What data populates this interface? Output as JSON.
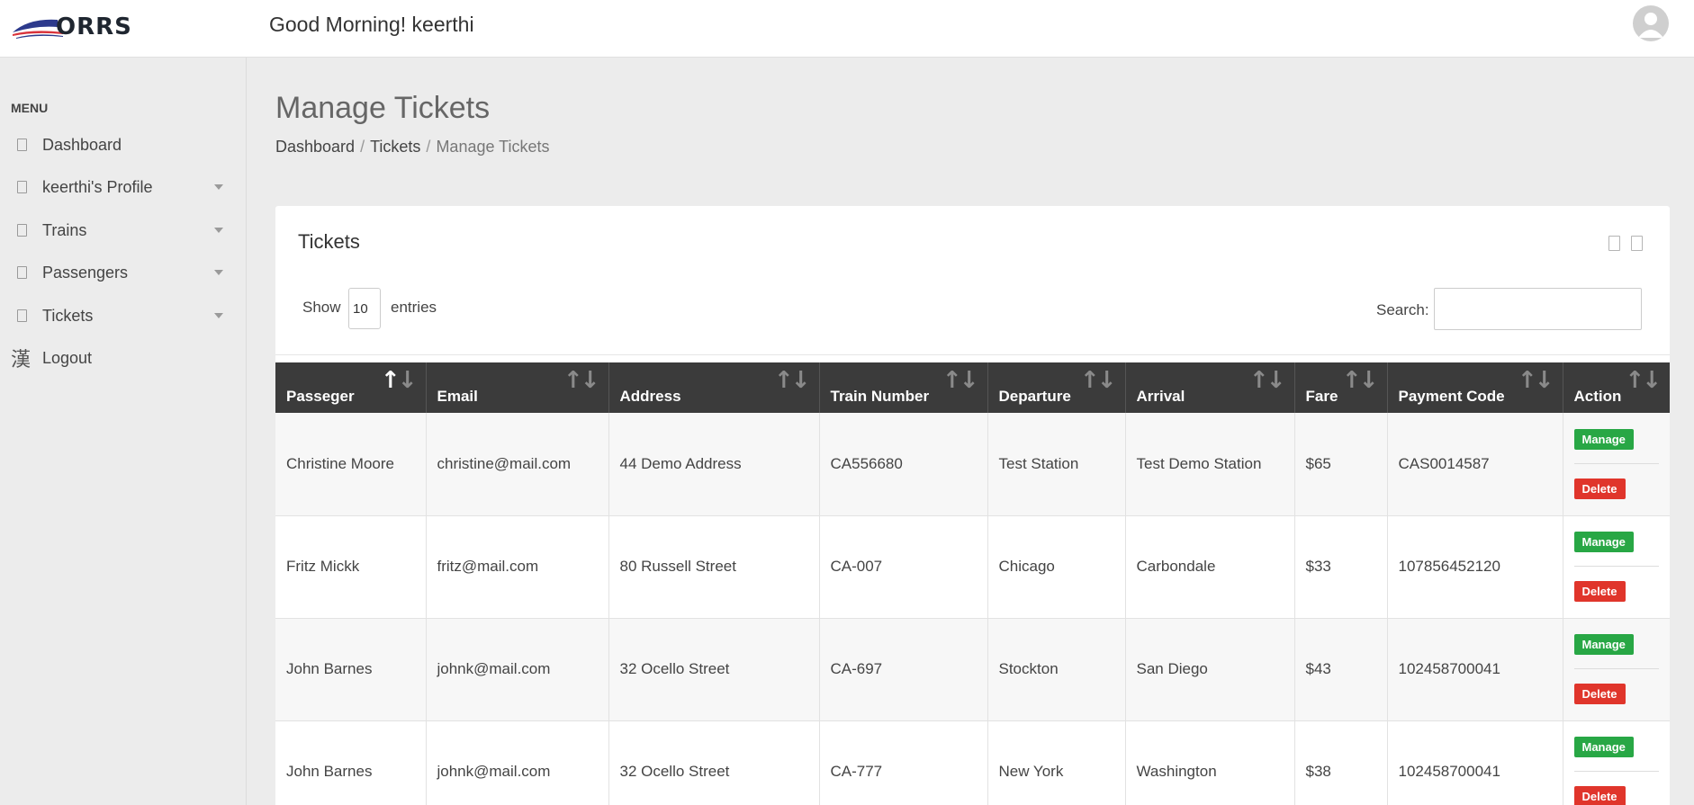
{
  "brand": {
    "logo_text": "ORRS"
  },
  "header": {
    "greeting": "Good Morning! keerthi"
  },
  "sidebar": {
    "heading": "MENU",
    "items": [
      {
        "label": "Dashboard",
        "icon": "dashboard-icon"
      },
      {
        "label": "keerthi's Profile",
        "icon": "profile-icon"
      },
      {
        "label": "Trains",
        "icon": "trains-icon"
      },
      {
        "label": "Passengers",
        "icon": "passengers-icon"
      },
      {
        "label": "Tickets",
        "icon": "tickets-icon"
      },
      {
        "label": "Logout",
        "icon": "logout-icon",
        "glyph": "漢"
      }
    ]
  },
  "page": {
    "title": "Manage Tickets",
    "breadcrumb": [
      "Dashboard",
      "Tickets",
      "Manage Tickets"
    ]
  },
  "card": {
    "title": "Tickets",
    "show_label": "Show",
    "show_value": "10",
    "entries_label": "entries",
    "search_label": "Search:"
  },
  "table": {
    "columns": [
      "Passeger",
      "Email",
      "Address",
      "Train Number",
      "Departure",
      "Arrival",
      "Fare",
      "Payment Code",
      "Action"
    ],
    "rows": [
      {
        "passenger": "Christine Moore",
        "email": "christine@mail.com",
        "address": "44 Demo Address",
        "train_number": "CA556680",
        "departure": "Test Station",
        "arrival": "Test Demo Station",
        "fare": "$65",
        "payment_code": "CAS0014587"
      },
      {
        "passenger": "Fritz Mickk",
        "email": "fritz@mail.com",
        "address": "80 Russell Street",
        "train_number": "CA-007",
        "departure": "Chicago",
        "arrival": "Carbondale",
        "fare": "$33",
        "payment_code": "107856452120"
      },
      {
        "passenger": "John Barnes",
        "email": "johnk@mail.com",
        "address": "32 Ocello Street",
        "train_number": "CA-697",
        "departure": "Stockton",
        "arrival": "San Diego",
        "fare": "$43",
        "payment_code": "102458700041"
      },
      {
        "passenger": "John Barnes",
        "email": "johnk@mail.com",
        "address": "32 Ocello Street",
        "train_number": "CA-777",
        "departure": "New York",
        "arrival": "Washington",
        "fare": "$38",
        "payment_code": "102458700041"
      }
    ],
    "manage_label": "Manage",
    "delete_label": "Delete"
  },
  "colors": {
    "manage": "#28a745",
    "delete": "#e0352b",
    "table_header": "#3b3b3b"
  }
}
